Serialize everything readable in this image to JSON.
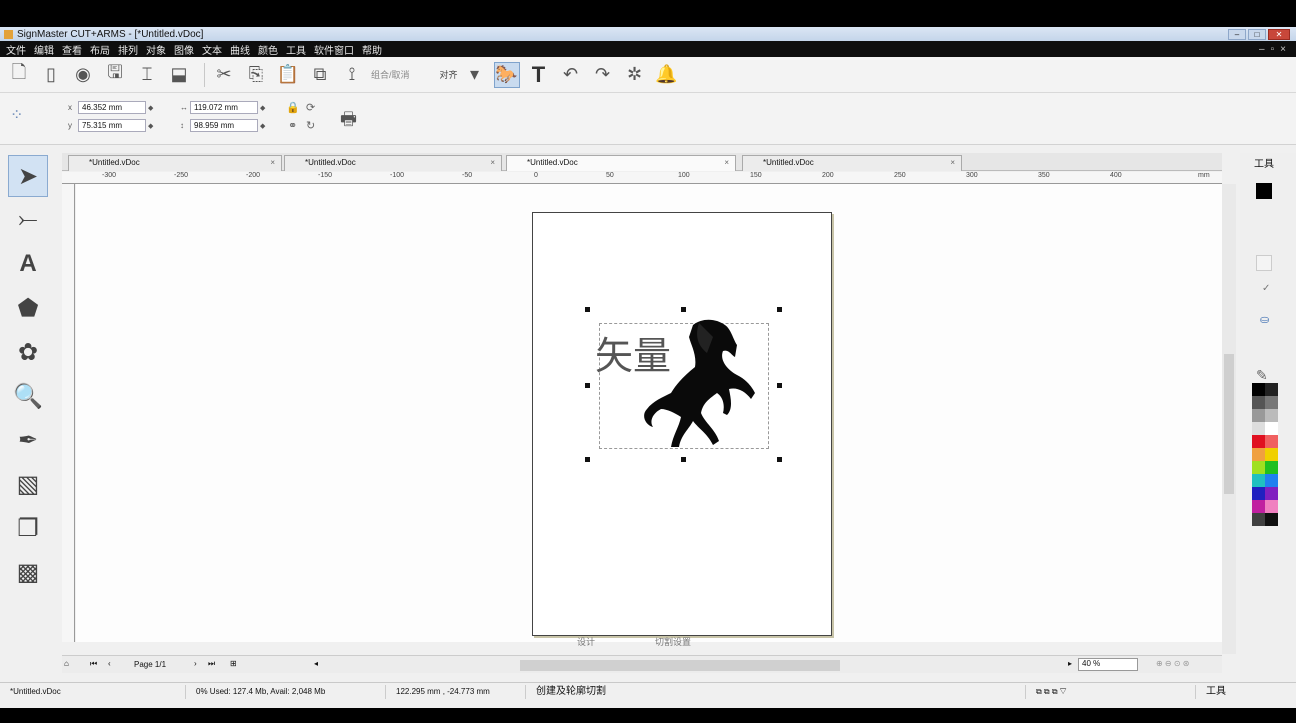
{
  "window": {
    "title": "SignMaster CUT+ARMS - [*Untitled.vDoc]"
  },
  "menu": {
    "items": [
      "文件",
      "编辑",
      "查看",
      "布局",
      "排列",
      "对象",
      "图像",
      "文本",
      "曲线",
      "颜色",
      "工具",
      "软件窗口",
      "帮助"
    ]
  },
  "toolbar": {
    "align_label": "对齐",
    "grayed_label": "组合/取消"
  },
  "properties": {
    "x_value": "46.352 mm",
    "y_value": "75.315 mm",
    "width_value": "119.072 mm",
    "height_value": "98.959 mm"
  },
  "tabs": [
    {
      "label": "*Untitled.vDoc"
    },
    {
      "label": "*Untitled.vDoc"
    },
    {
      "label": "*Untitled.vDoc"
    },
    {
      "label": "*Untitled.vDoc"
    }
  ],
  "ruler": {
    "labels": [
      "-300",
      "-250",
      "-200",
      "-150",
      "-100",
      "-50",
      "0",
      "50",
      "100",
      "150",
      "200",
      "250",
      "300",
      "350",
      "400",
      "mm"
    ]
  },
  "canvas": {
    "text_object": "矢量",
    "page_footer_left": "设计",
    "page_footer_right": "切割设置"
  },
  "navigation": {
    "page_label": "Page 1/1",
    "zoom": "40 %"
  },
  "right_panel": {
    "title": "工具"
  },
  "palette": [
    "#000000",
    "#222222",
    "#555555",
    "#777777",
    "#999999",
    "#bbbbbb",
    "#dddddd",
    "#ffffff",
    "#e01020",
    "#f06060",
    "#f0a040",
    "#f0d000",
    "#a0e020",
    "#20c020",
    "#20c0c0",
    "#2080f0",
    "#2020c0",
    "#8020c0",
    "#c020a0",
    "#f080c0",
    "#404040",
    "#101010"
  ],
  "status": {
    "file": "*Untitled.vDoc",
    "memory": "0% Used: 127.4 Mb, Avail: 2,048 Mb",
    "cursor": "122.295 mm , -24.773 mm",
    "hint": "创建及轮廓切割",
    "tools": "工具"
  }
}
